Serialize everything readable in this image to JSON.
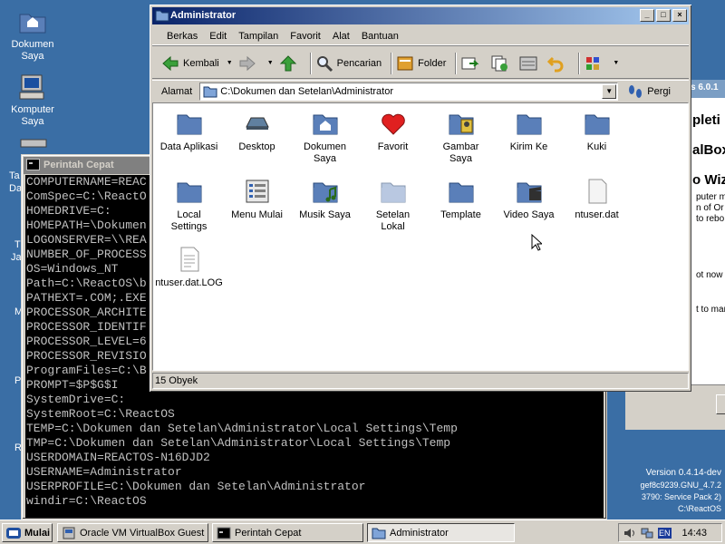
{
  "desktop": {
    "icons": [
      {
        "label_line1": "Dokumen",
        "label_line2": "Saya"
      },
      {
        "label_line1": "Komputer",
        "label_line2": "Saya"
      }
    ],
    "partial_labels": [
      "Ta",
      "Da",
      "T",
      "Ja",
      "M",
      "P",
      "R"
    ]
  },
  "bg_installer": {
    "title_fragment": "s 6.0.1",
    "heading_lines": [
      "pleti",
      "alBox",
      "o Wiz"
    ],
    "text_lines": [
      "puter m",
      "n of Or",
      "to rebo"
    ],
    "line2": "ot now",
    "line3": "t to mar"
  },
  "version_info": {
    "line1": "Version 0.4.14-dev",
    "line2": "gef8c9239.GNU_4.7.2",
    "line3": "3790: Service Pack 2)",
    "line4": "C:\\ReactOS"
  },
  "console": {
    "title": "Perintah Cepat",
    "lines": [
      "COMPUTERNAME=REAC",
      "ComSpec=C:\\ReactO",
      "HOMEDRIVE=C:",
      "HOMEPATH=\\Dokumen",
      "LOGONSERVER=\\\\REA",
      "NUMBER_OF_PROCESS",
      "OS=Windows_NT",
      "Path=C:\\ReactOS\\b",
      "PATHEXT=.COM;.EXE",
      "PROCESSOR_ARCHITE",
      "PROCESSOR_IDENTIF",
      "PROCESSOR_LEVEL=6",
      "PROCESSOR_REVISIO",
      "ProgramFiles=C:\\B",
      "PROMPT=$P$G$I",
      "SystemDrive=C:",
      "SystemRoot=C:\\ReactOS",
      "TEMP=C:\\Dokumen dan Setelan\\Administrator\\Local Settings\\Temp",
      "TMP=C:\\Dokumen dan Setelan\\Administrator\\Local Settings\\Temp",
      "USERDOMAIN=REACTOS-N16DJD2",
      "USERNAME=Administrator",
      "USERPROFILE=C:\\Dokumen dan Setelan\\Administrator",
      "windir=C:\\ReactOS"
    ]
  },
  "explorer": {
    "title": "Administrator",
    "menu": [
      "Berkas",
      "Edit",
      "Tampilan",
      "Favorit",
      "Alat",
      "Bantuan"
    ],
    "toolbar": {
      "back": "Kembali",
      "search": "Pencarian",
      "folders": "Folder"
    },
    "address_label": "Alamat",
    "address_value": "C:\\Dokumen dan Setelan\\Administrator",
    "go_label": "Pergi",
    "items": [
      {
        "l1": "Data Aplikasi",
        "l2": "",
        "icon": "folder-icon"
      },
      {
        "l1": "Desktop",
        "l2": "",
        "icon": "desktop-icon"
      },
      {
        "l1": "Dokumen",
        "l2": "Saya",
        "icon": "home-folder-icon"
      },
      {
        "l1": "Favorit",
        "l2": "",
        "icon": "heart-icon"
      },
      {
        "l1": "Gambar",
        "l2": "Saya",
        "icon": "pictures-folder-icon"
      },
      {
        "l1": "Kirim Ke",
        "l2": "",
        "icon": "folder-icon"
      },
      {
        "l1": "Kuki",
        "l2": "",
        "icon": "folder-icon"
      },
      {
        "l1": "Local",
        "l2": "Settings",
        "icon": "folder-icon"
      },
      {
        "l1": "Menu Mulai",
        "l2": "",
        "icon": "start-menu-icon"
      },
      {
        "l1": "Musik Saya",
        "l2": "",
        "icon": "music-folder-icon"
      },
      {
        "l1": "Setelan",
        "l2": "Lokal",
        "icon": "faded-folder-icon"
      },
      {
        "l1": "Template",
        "l2": "",
        "icon": "folder-icon"
      },
      {
        "l1": "Video Saya",
        "l2": "",
        "icon": "video-folder-icon"
      },
      {
        "l1": "ntuser.dat",
        "l2": "",
        "icon": "file-icon"
      },
      {
        "l1": "ntuser.dat.LOG",
        "l2": "",
        "icon": "text-file-icon"
      }
    ],
    "status": "15 Obyek"
  },
  "taskbar": {
    "start_label": "Mulai",
    "tasks": [
      {
        "label": "Oracle VM VirtualBox Guest ..."
      },
      {
        "label": "Perintah Cepat"
      },
      {
        "label": "Administrator"
      }
    ],
    "lang": "EN",
    "clock": "14:43"
  },
  "colors": {
    "desktop": "#3a6ea5",
    "title_active": "#0a246a",
    "title_inactive": "#808080",
    "folder": "#5a7fb8"
  }
}
